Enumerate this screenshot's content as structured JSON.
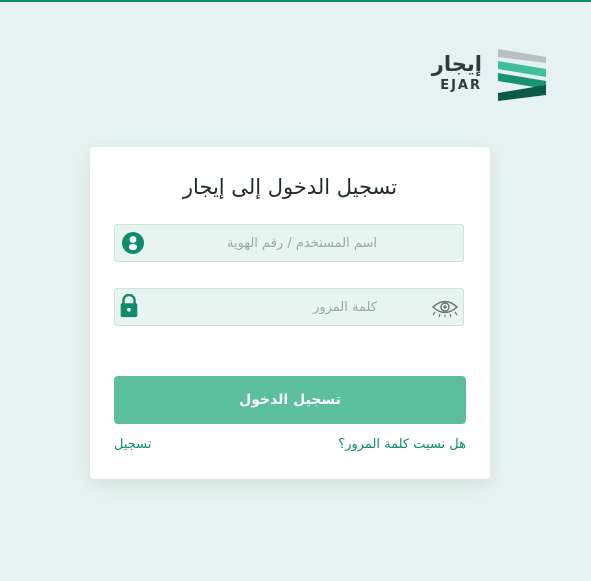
{
  "brand": {
    "name_ar": "إيجار",
    "name_en": "EJAR",
    "colors": {
      "primary": "#0e8a6c",
      "accent": "#3fbf9b",
      "light": "#b9bec0",
      "dark": "#0a5a46"
    }
  },
  "login": {
    "title": "تسجيل الدخول إلى إيجار",
    "username": {
      "placeholder": "اسم المستخدم / رقم الهوية",
      "value": ""
    },
    "password": {
      "placeholder": "كلمة المرور",
      "value": ""
    },
    "submit_label": "تسجيل الدخول",
    "forgot_label": "هل نسيت كلمة المرور؟",
    "register_label": "تسجيل"
  },
  "icons": {
    "user": "user-circle-icon",
    "lock": "lock-icon",
    "eye": "eye-icon",
    "logo": "ejar-logo-mark"
  }
}
